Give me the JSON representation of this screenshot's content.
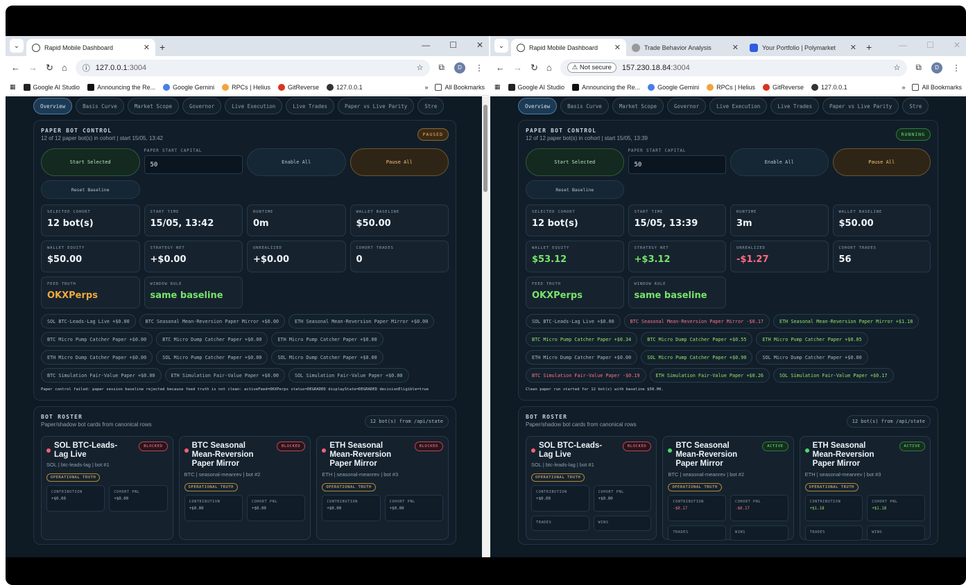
{
  "left": {
    "tabs": [
      {
        "label": "Rapid Mobile Dashboard",
        "active": true
      }
    ],
    "url": "127.0.0.1",
    "url_suffix": ":3004",
    "state": "PAUSED",
    "cohort_line": "12 of 12 paper bot(s) in cohort | start 15/05, 13:42",
    "stats": [
      {
        "label": "SELECTED COHORT",
        "value": "12 bot(s)",
        "tone": ""
      },
      {
        "label": "START TIME",
        "value": "15/05, 13:42",
        "tone": ""
      },
      {
        "label": "RUNTIME",
        "value": "0m",
        "tone": ""
      },
      {
        "label": "WALLET BASELINE",
        "value": "$50.00",
        "tone": ""
      },
      {
        "label": "WALLET EQUITY",
        "value": "$50.00",
        "tone": ""
      },
      {
        "label": "STRATEGY NET",
        "value": "+$0.00",
        "tone": ""
      },
      {
        "label": "UNREALIZED",
        "value": "+$0.00",
        "tone": ""
      },
      {
        "label": "COHORT TRADES",
        "value": "0",
        "tone": ""
      },
      {
        "label": "FEED TRUTH",
        "value": "OKXPerps",
        "tone": "orange"
      },
      {
        "label": "WINDOW RULE",
        "value": "same baseline",
        "tone": "green"
      }
    ],
    "chips": [
      {
        "text": "SOL BTC-Leads-Lag Live +$0.00",
        "tone": ""
      },
      {
        "text": "BTC Seasonal Mean-Reversion Paper Mirror +$0.00",
        "tone": ""
      },
      {
        "text": "ETH Seasonal Mean-Reversion Paper Mirror +$0.00",
        "tone": ""
      },
      {
        "text": "BTC Micro Pump Catcher Paper +$0.00",
        "tone": ""
      },
      {
        "text": "BTC Micro Dump Catcher Paper +$0.00",
        "tone": ""
      },
      {
        "text": "ETH Micro Pump Catcher Paper +$0.00",
        "tone": ""
      },
      {
        "text": "ETH Micro Dump Catcher Paper +$0.00",
        "tone": ""
      },
      {
        "text": "SOL Micro Pump Catcher Paper +$0.00",
        "tone": ""
      },
      {
        "text": "SOL Micro Dump Catcher Paper +$0.00",
        "tone": ""
      },
      {
        "text": "BTC Simulation Fair-Value Paper +$0.00",
        "tone": ""
      },
      {
        "text": "ETH Simulation Fair-Value Paper +$0.00",
        "tone": ""
      },
      {
        "text": "SOL Simulation Fair-Value Paper +$0.00",
        "tone": ""
      }
    ],
    "message": "Paper control failed: paper session baseline rejected because feed truth is not clean: activeFeed=OKXPerps status=DEGRADED displayState=DEGRADED decisionEligible=true",
    "cards": [
      {
        "name": "SOL BTC-Leads-Lag Live",
        "meta": "SOL | btc-leads-lag | bot #1",
        "badge": "BLOCKED",
        "status": "red",
        "contribution": "+$0.00",
        "cohort_pnl": "+$0.00",
        "ctone": "",
        "ptone": ""
      },
      {
        "name": "BTC Seasonal Mean-Reversion Paper Mirror",
        "meta": "BTC | seasonal-meanrev | bot #2",
        "badge": "BLOCKED",
        "status": "red",
        "contribution": "+$0.00",
        "cohort_pnl": "+$0.00",
        "ctone": "",
        "ptone": ""
      },
      {
        "name": "ETH Seasonal Mean-Reversion Paper Mirror",
        "meta": "ETH | seasonal-meanrev | bot #3",
        "badge": "BLOCKED",
        "status": "red",
        "contribution": "+$0.00",
        "cohort_pnl": "+$0.00",
        "ctone": "",
        "ptone": ""
      }
    ]
  },
  "right": {
    "tabs": [
      {
        "label": "Rapid Mobile Dashboard",
        "active": true
      },
      {
        "label": "Trade Behavior Analysis",
        "active": false
      },
      {
        "label": "Your Portfolio | Polymarket",
        "active": false
      }
    ],
    "not_secure": "Not secure",
    "url": "157.230.18.84",
    "url_suffix": ":3004",
    "state": "RUNNING",
    "cohort_line": "12 of 12 paper bot(s) in cohort | start 15/05, 13:39",
    "stats": [
      {
        "label": "SELECTED COHORT",
        "value": "12 bot(s)",
        "tone": ""
      },
      {
        "label": "START TIME",
        "value": "15/05, 13:39",
        "tone": ""
      },
      {
        "label": "RUNTIME",
        "value": "3m",
        "tone": ""
      },
      {
        "label": "WALLET BASELINE",
        "value": "$50.00",
        "tone": ""
      },
      {
        "label": "WALLET EQUITY",
        "value": "$53.12",
        "tone": "green"
      },
      {
        "label": "STRATEGY NET",
        "value": "+$3.12",
        "tone": "green"
      },
      {
        "label": "UNREALIZED",
        "value": "-$1.27",
        "tone": "red"
      },
      {
        "label": "COHORT TRADES",
        "value": "56",
        "tone": ""
      },
      {
        "label": "FEED TRUTH",
        "value": "OKXPerps",
        "tone": "green"
      },
      {
        "label": "WINDOW RULE",
        "value": "same baseline",
        "tone": "green"
      }
    ],
    "chips": [
      {
        "text": "SOL BTC-Leads-Lag Live +$0.00",
        "tone": ""
      },
      {
        "text": "BTC Seasonal Mean-Reversion Paper Mirror -$0.17",
        "tone": "neg"
      },
      {
        "text": "ETH Seasonal Mean-Reversion Paper Mirror +$1.18",
        "tone": "pos"
      },
      {
        "text": "BTC Micro Pump Catcher Paper +$0.34",
        "tone": "pos"
      },
      {
        "text": "BTC Micro Dump Catcher Paper +$0.55",
        "tone": "pos"
      },
      {
        "text": "ETH Micro Pump Catcher Paper +$0.05",
        "tone": "pos"
      },
      {
        "text": "ETH Micro Dump Catcher Paper +$0.00",
        "tone": ""
      },
      {
        "text": "SOL Micro Pump Catcher Paper +$0.90",
        "tone": "pos"
      },
      {
        "text": "SOL Micro Dump Catcher Paper +$0.00",
        "tone": ""
      },
      {
        "text": "BTC Simulation Fair-Value Paper -$0.19",
        "tone": "neg"
      },
      {
        "text": "ETH Simulation Fair-Value Paper +$0.26",
        "tone": "pos"
      },
      {
        "text": "SOL Simulation Fair-Value Paper +$0.17",
        "tone": "pos"
      }
    ],
    "message": "Clean paper run started for 12 bot(s) with baseline $50.00.",
    "cards": [
      {
        "name": "SOL BTC-Leads-Lag Live",
        "meta": "SOL | btc-leads-lag | bot #1",
        "badge": "BLOCKED",
        "status": "red",
        "contribution": "+$0.00",
        "cohort_pnl": "+$0.00",
        "ctone": "",
        "ptone": ""
      },
      {
        "name": "BTC Seasonal Mean-Reversion Paper Mirror",
        "meta": "BTC | seasonal-meanrev | bot #2",
        "badge": "ACTIVE",
        "status": "green",
        "contribution": "-$0.17",
        "cohort_pnl": "-$0.17",
        "ctone": "neg",
        "ptone": "neg"
      },
      {
        "name": "ETH Seasonal Mean-Reversion Paper Mirror",
        "meta": "ETH | seasonal-meanrev | bot #3",
        "badge": "ACTIVE",
        "status": "green",
        "contribution": "+$1.18",
        "cohort_pnl": "+$1.18",
        "ctone": "pos",
        "ptone": "pos"
      }
    ]
  },
  "shared": {
    "nav_tabs": [
      "Overview",
      "Basis Curve",
      "Market Scope",
      "Governor",
      "Live Execution",
      "Live Trades",
      "Paper vs Live Parity",
      "Stre"
    ],
    "bookmarks": [
      "Google AI Studio",
      "Announcing the Re...",
      "Google Gemini",
      "RPCs | Helius",
      "GitReverse",
      "127.0.0.1"
    ],
    "bookmark_colors": [
      "#222222",
      "#111111",
      "#4a7ee8",
      "#f2a43b",
      "#d9341f",
      "#333333"
    ],
    "all_bookmarks": "All Bookmarks",
    "paper_title": "PAPER BOT CONTROL",
    "start_selected": "Start Selected",
    "capital_label": "PAPER START CAPITAL",
    "capital_value": "50",
    "enable_all": "Enable All",
    "pause_all": "Pause All",
    "reset_baseline": "Reset Baseline",
    "roster_title": "BOT ROSTER",
    "roster_sub": "Paper/shadow bot cards from canonical rows",
    "roster_count": "12 bot(s) from /api/state",
    "op_truth": "OPERATIONAL TRUTH",
    "contribution_label": "CONTRIBUTION",
    "cohort_pnl_label": "COHORT PNL",
    "trades_label": "TRADES",
    "wins_label": "WINS",
    "avatar_letter": "D"
  }
}
